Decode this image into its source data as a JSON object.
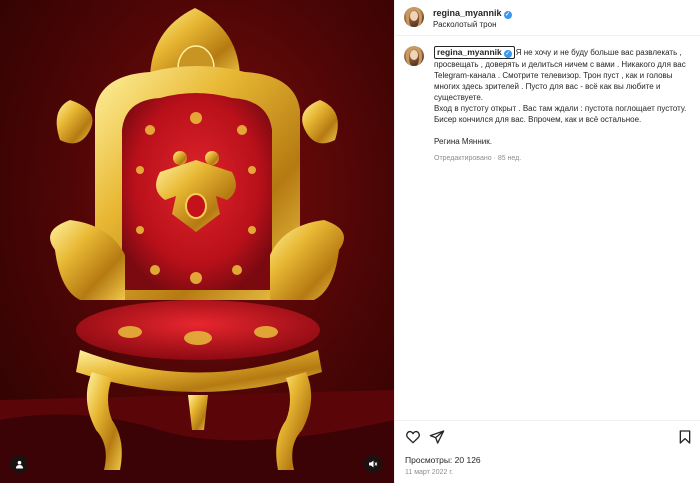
{
  "header": {
    "username": "regina_myannik",
    "location": "Расколотый трон"
  },
  "caption": {
    "username": "regina_myannik",
    "lines": [
      "Я не хочу и не буду больше вас развлекать , просвещать , доверять и делиться ничем с вами . Никакого для вас Telegram-канала . Смотрите телевизор. Трон пуст , как и головы многих здесь зрителей . Пусто для вас - всё как вы любите и существуете.",
      "Вход в пустоту открыт . Вас там ждали : пустота поглощает пустоту. Бисер кончился для вас. Впрочем, как и всё остальное."
    ],
    "signature": "Регина Мянник.",
    "meta": "Отредактировано · 85 нед."
  },
  "stats": {
    "views": "Просмотры: 20 126",
    "date": "11 март 2022 г."
  },
  "icons": {
    "tag": "person-tag-icon",
    "mute": "speaker-muted-icon",
    "like": "heart-icon",
    "share": "paper-plane-icon",
    "save": "bookmark-icon"
  },
  "colors": {
    "verified": "#3897f0",
    "velvet": "#c4121a",
    "gold": "#e0b230"
  }
}
